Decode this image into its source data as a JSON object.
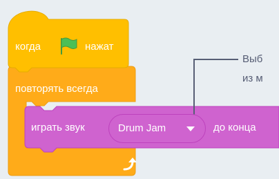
{
  "blocks": {
    "hat": {
      "label_before": "когда",
      "label_after": "нажат",
      "flag_icon": "green-flag-icon"
    },
    "forever": {
      "label": "повторять всегда",
      "loop_icon": "loop-arrow-icon"
    },
    "play_sound": {
      "label_before": "играть звук",
      "sound": "Drum Jam",
      "label_after": "до конца"
    }
  },
  "annotation": {
    "line1": "Выб",
    "line2": "из м"
  },
  "colors": {
    "control": "#ffab19",
    "control_dark": "#ec9c13",
    "events": "#ffbf00",
    "events_dark": "#e6ac00",
    "sound": "#cf63cf",
    "sound_dark": "#bd42bd",
    "flag": "#4cbf56",
    "annotation_text": "#575e75"
  }
}
